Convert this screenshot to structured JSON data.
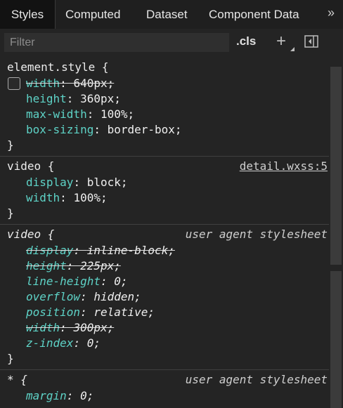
{
  "tabs": [
    {
      "label": "Styles"
    },
    {
      "label": "Computed"
    },
    {
      "label": "Dataset"
    },
    {
      "label": "Component Data"
    }
  ],
  "more_icon": "»",
  "filter": {
    "placeholder": "Filter",
    "value": ""
  },
  "cls_label": ".cls",
  "add_icon": "+",
  "rules": [
    {
      "selector": "element.style {",
      "source": "",
      "closing": "}",
      "declarations": [
        {
          "prop": "width",
          "value": "640px;",
          "struck": true
        },
        {
          "prop": "height",
          "value": "360px;",
          "struck": false
        },
        {
          "prop": "max-width",
          "value": "100%;",
          "struck": false
        },
        {
          "prop": "box-sizing",
          "value": "border-box;",
          "struck": false
        }
      ]
    },
    {
      "selector": "video {",
      "source": "detail.wxss:5",
      "closing": "}",
      "declarations": [
        {
          "prop": "display",
          "value": "block;",
          "struck": false
        },
        {
          "prop": "width",
          "value": "100%;",
          "struck": false
        }
      ]
    },
    {
      "selector": "video {",
      "source": "user agent stylesheet",
      "closing": "}",
      "declarations": [
        {
          "prop": "display",
          "value": "inline-block;",
          "struck": true
        },
        {
          "prop": "height",
          "value": "225px;",
          "struck": true
        },
        {
          "prop": "line-height",
          "value": "0;",
          "struck": false
        },
        {
          "prop": "overflow",
          "value": "hidden;",
          "struck": false
        },
        {
          "prop": "position",
          "value": "relative;",
          "struck": false
        },
        {
          "prop": "width",
          "value": "300px;",
          "struck": true
        },
        {
          "prop": "z-index",
          "value": "0;",
          "struck": false
        }
      ]
    },
    {
      "selector": "* {",
      "source": "user agent stylesheet",
      "declarations": [
        {
          "prop": "margin",
          "value": "0;",
          "struck": false
        }
      ]
    }
  ]
}
